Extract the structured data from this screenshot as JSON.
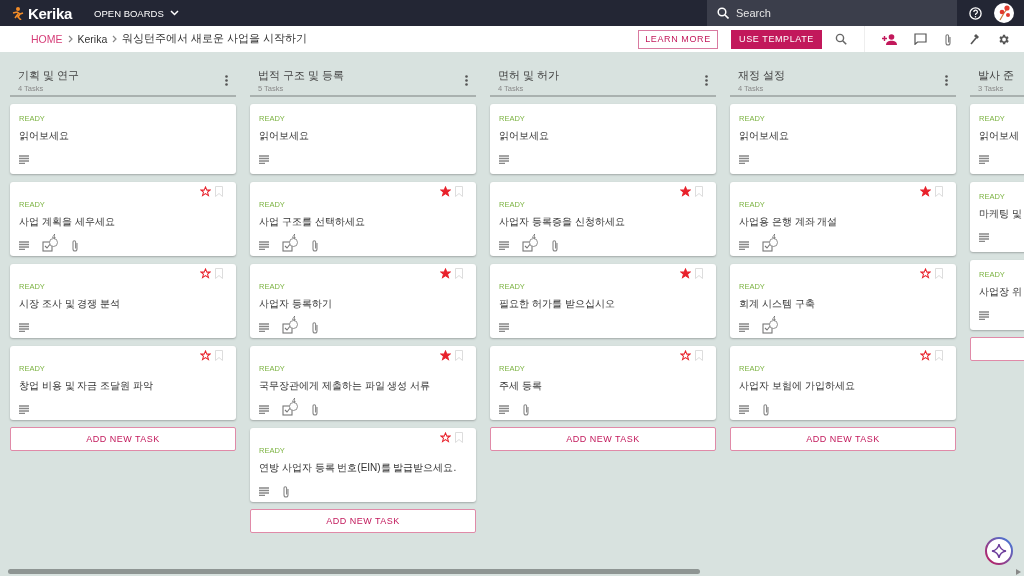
{
  "topbar": {
    "logo": "Kerika",
    "boards_menu": "OPEN BOARDS",
    "search": {
      "placeholder": "Search"
    }
  },
  "breadcrumb": {
    "items": [
      "HOME",
      "Kerika",
      "워싱턴주에서 새로운 사업을 시작하기"
    ]
  },
  "actions": {
    "learn_more": "LEARN MORE",
    "use_template": "USE TEMPLATE"
  },
  "columns": [
    {
      "title": "기획 및 연구",
      "count": "4 Tasks",
      "add_button": "ADD NEW TASK",
      "cards": [
        {
          "status": "READY",
          "title": "읽어보세요",
          "attachment": false
        },
        {
          "status": "READY",
          "title": "사업 계획을 세우세요",
          "starred": false,
          "checklist": "4",
          "attachment": true
        },
        {
          "status": "READY",
          "title": "시장 조사 및 경쟁 분석",
          "starred": false,
          "attachment": false
        },
        {
          "status": "READY",
          "title": "창업 비용 및 자금 조달원 파악",
          "starred": false,
          "attachment": false
        }
      ]
    },
    {
      "title": "법적 구조 및 등록",
      "count": "5 Tasks",
      "add_button": "ADD NEW TASK",
      "cards": [
        {
          "status": "READY",
          "title": "읽어보세요",
          "attachment": false
        },
        {
          "status": "READY",
          "title": "사업 구조를 선택하세요",
          "starred": true,
          "checklist": "4",
          "attachment": true
        },
        {
          "status": "READY",
          "title": "사업자 등록하기",
          "starred": true,
          "checklist": "4",
          "attachment": true
        },
        {
          "status": "READY",
          "title": "국무장관에게 제출하는 파일 생성 서류",
          "starred": true,
          "checklist": "4",
          "attachment": true
        },
        {
          "status": "READY",
          "title": "연방 사업자 등록 번호(EIN)를 발급받으세요.",
          "starred": false,
          "attachment": true
        }
      ]
    },
    {
      "title": "면허 및 허가",
      "count": "4 Tasks",
      "add_button": "ADD NEW TASK",
      "cards": [
        {
          "status": "READY",
          "title": "읽어보세요",
          "attachment": false
        },
        {
          "status": "READY",
          "title": "사업자 등록증을 신청하세요",
          "starred": true,
          "checklist": "4",
          "attachment": true
        },
        {
          "status": "READY",
          "title": "필요한 허가를 받으십시오",
          "starred": true,
          "attachment": false
        },
        {
          "status": "READY",
          "title": "주세 등록",
          "starred": false,
          "attachment": true
        }
      ]
    },
    {
      "title": "재정 설정",
      "count": "4 Tasks",
      "add_button": "ADD NEW TASK",
      "cards": [
        {
          "status": "READY",
          "title": "읽어보세요",
          "attachment": false
        },
        {
          "status": "READY",
          "title": "사업용 은행 계좌 개설",
          "starred": true,
          "checklist": "4",
          "attachment": false
        },
        {
          "status": "READY",
          "title": "회계 시스템 구축",
          "starred": false,
          "checklist": "4",
          "attachment": false
        },
        {
          "status": "READY",
          "title": "사업자 보험에 가입하세요",
          "starred": false,
          "attachment": true
        }
      ]
    },
    {
      "title": "발사 준",
      "count": "3 Tasks",
      "cards": [
        {
          "status": "READY",
          "title": "읽어보세",
          "attachment": false
        },
        {
          "status": "READY",
          "title": "마케팅 및",
          "attachment": false
        },
        {
          "status": "READY",
          "title": "사업장 위",
          "attachment": false
        }
      ]
    }
  ]
}
